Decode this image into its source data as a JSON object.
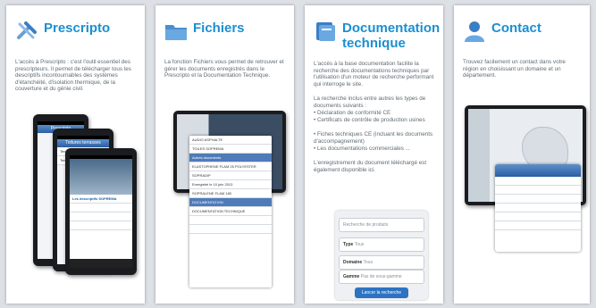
{
  "panels": [
    {
      "title": "Prescripto",
      "icon": "tools-icon",
      "description": "L'accès à Prescripto : c'est l'outil essentiel des prescripteurs. Il permet de télécharger tous les descriptifs incontournables des systèmes d'étanchéité, d'isolation thermique, de la couverture et du génie civil."
    },
    {
      "title": "Fichiers",
      "icon": "folder-icon",
      "description": "La fonction Fichiers vous permet de retrouver et gérer les documents enregistrés dans le Prescripto et la Documentation Technique."
    },
    {
      "title_line1": "Documentation",
      "title_line2": "technique",
      "icon": "book-icon",
      "description": "L'accès à la base documentation facilite la recherche des documentations techniques par l'utilisation d'un moteur de recherche performant qui interroge le site.",
      "list_intro": "La recherche inclus entre autres les types de documents suivants :",
      "list": [
        "• Déclaration de conformité CE",
        "• Certificats de contrôle de production usines",
        "• Fiches techniques CE (incluant les documents d'accompagnement)",
        "• Les documentations commerciales ..."
      ],
      "footer": "L'enregistrement du document téléchargé est également disponible ici.",
      "form": {
        "search_placeholder": "Recherche de produits",
        "type_label": "Type",
        "type_value": "Tous",
        "domain_label": "Domaine",
        "domain_value": "Tous",
        "range_label": "Gamme",
        "range_value": "Pas de sous-gamme",
        "submit_label": "Lancer la recherche"
      }
    },
    {
      "title": "Contact",
      "icon": "person-icon",
      "description": "Trouvez facilement un contact dans votre région en choisissant un domaine et un département."
    }
  ],
  "mock": {
    "prescripto_header": "Prescripto",
    "prescripto_rows": [
      "Toitures terrasses",
      "Terrasses inaccessibles",
      "Terrasses accessibles"
    ],
    "prescripto_list_title": "Les descriptifs SOPREMA",
    "fichiers_rows": [
      "AUDIO ASPHALTE",
      "TOILES SOPREMA",
      "Autres documents",
      "ELASTOPHENE FLAM 25 POLYESTER",
      "SOPRADIP",
      "Enregistré le 10 juin 2013",
      "SOPRALENE FLAM 180",
      "DOCUMENTATION",
      "DOCUMENTATION TECHNIQUE"
    ]
  },
  "colors": {
    "title": "#1b8fd1",
    "text": "#5f6b73",
    "bg": "#dde1e6"
  }
}
